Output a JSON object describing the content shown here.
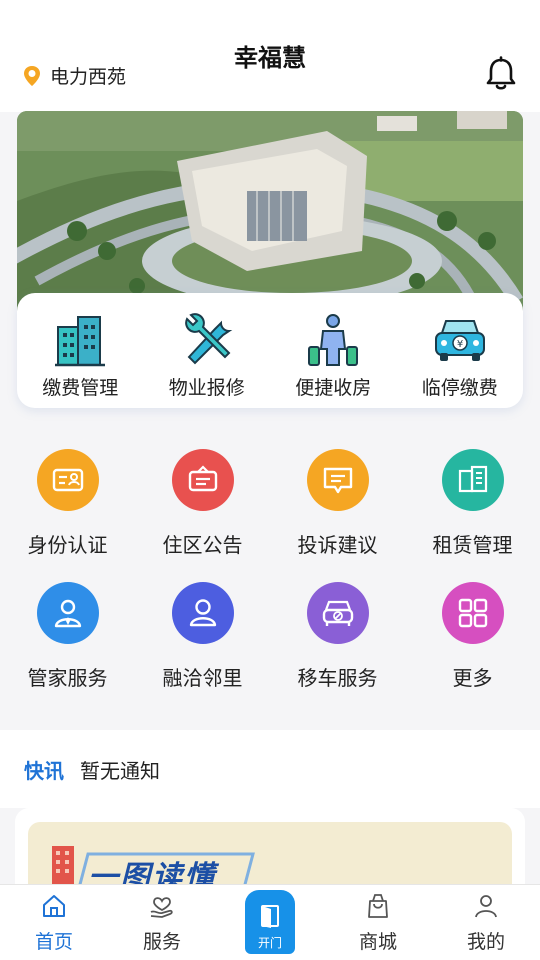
{
  "header": {
    "title": "幸福慧",
    "location": "电力西苑"
  },
  "quick_actions": [
    {
      "label": "缴费管理",
      "icon": "building-icon"
    },
    {
      "label": "物业报修",
      "icon": "tools-icon"
    },
    {
      "label": "便捷收房",
      "icon": "person-luggage-icon"
    },
    {
      "label": "临停缴费",
      "icon": "car-fee-icon"
    }
  ],
  "services": [
    {
      "label": "身份认证",
      "icon": "id-card-icon",
      "color": "#f5a623"
    },
    {
      "label": "住区公告",
      "icon": "notice-icon",
      "color": "#e8514f"
    },
    {
      "label": "投诉建议",
      "icon": "message-icon",
      "color": "#f5a623"
    },
    {
      "label": "租赁管理",
      "icon": "book-icon",
      "color": "#26b6a0"
    },
    {
      "label": "管家服务",
      "icon": "butler-icon",
      "color": "#2f8ee8"
    },
    {
      "label": "融洽邻里",
      "icon": "neighbors-icon",
      "color": "#4d5ee0"
    },
    {
      "label": "移车服务",
      "icon": "move-car-icon",
      "color": "#8a5fd6"
    },
    {
      "label": "更多",
      "icon": "grid-icon",
      "color": "#d64fc0"
    }
  ],
  "news": {
    "tag": "快讯",
    "message": "暂无通知"
  },
  "promo": {
    "text": "一图读懂"
  },
  "tabs": [
    {
      "label": "首页",
      "icon": "home-icon"
    },
    {
      "label": "服务",
      "icon": "service-icon"
    },
    {
      "label": "开门",
      "icon": "door-icon"
    },
    {
      "label": "商城",
      "icon": "shopping-bag-icon"
    },
    {
      "label": "我的",
      "icon": "user-icon"
    }
  ],
  "colors": {
    "accent": "#1f73d6",
    "open_button": "#1791e8",
    "pin": "#f5a623"
  }
}
